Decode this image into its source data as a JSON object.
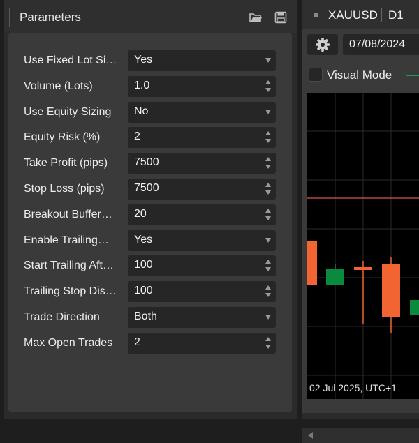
{
  "params_panel": {
    "title": "Parameters",
    "icons": [
      "open-folder-icon",
      "save-icon"
    ],
    "rows": [
      {
        "label": "Use Fixed Lot Si…",
        "value": "Yes",
        "control": "dropdown"
      },
      {
        "label": "Volume (Lots)",
        "value": "1.0",
        "control": "spinner"
      },
      {
        "label": "Use Equity Sizing",
        "value": "No",
        "control": "dropdown"
      },
      {
        "label": "Equity Risk (%)",
        "value": "2",
        "control": "spinner"
      },
      {
        "label": "Take Profit (pips)",
        "value": "7500",
        "control": "spinner"
      },
      {
        "label": "Stop Loss (pips)",
        "value": "7500",
        "control": "spinner"
      },
      {
        "label": "Breakout Buffer…",
        "value": "20",
        "control": "spinner"
      },
      {
        "label": "Enable Trailing…",
        "value": "Yes",
        "control": "dropdown"
      },
      {
        "label": "Start Trailing Aft…",
        "value": "100",
        "control": "spinner"
      },
      {
        "label": "Trailing Stop Dis…",
        "value": "100",
        "control": "spinner"
      },
      {
        "label": "Trade Direction",
        "value": "Both",
        "control": "dropdown"
      },
      {
        "label": "Max Open Trades",
        "value": "2",
        "control": "spinner"
      }
    ]
  },
  "chart_panel": {
    "symbol": "XAUUSD",
    "timeframe": "D1",
    "start_date": "07/08/2024",
    "visual_mode_label": "Visual Mode",
    "visual_mode_checked": false,
    "bottom_date": "02 Jul 2025, UTC+1",
    "colors": {
      "bear": "#f26532",
      "bull": "#0a8a3c",
      "price_line": "#d9534f",
      "grid": "#2a2a2a",
      "background": "#000000"
    }
  }
}
